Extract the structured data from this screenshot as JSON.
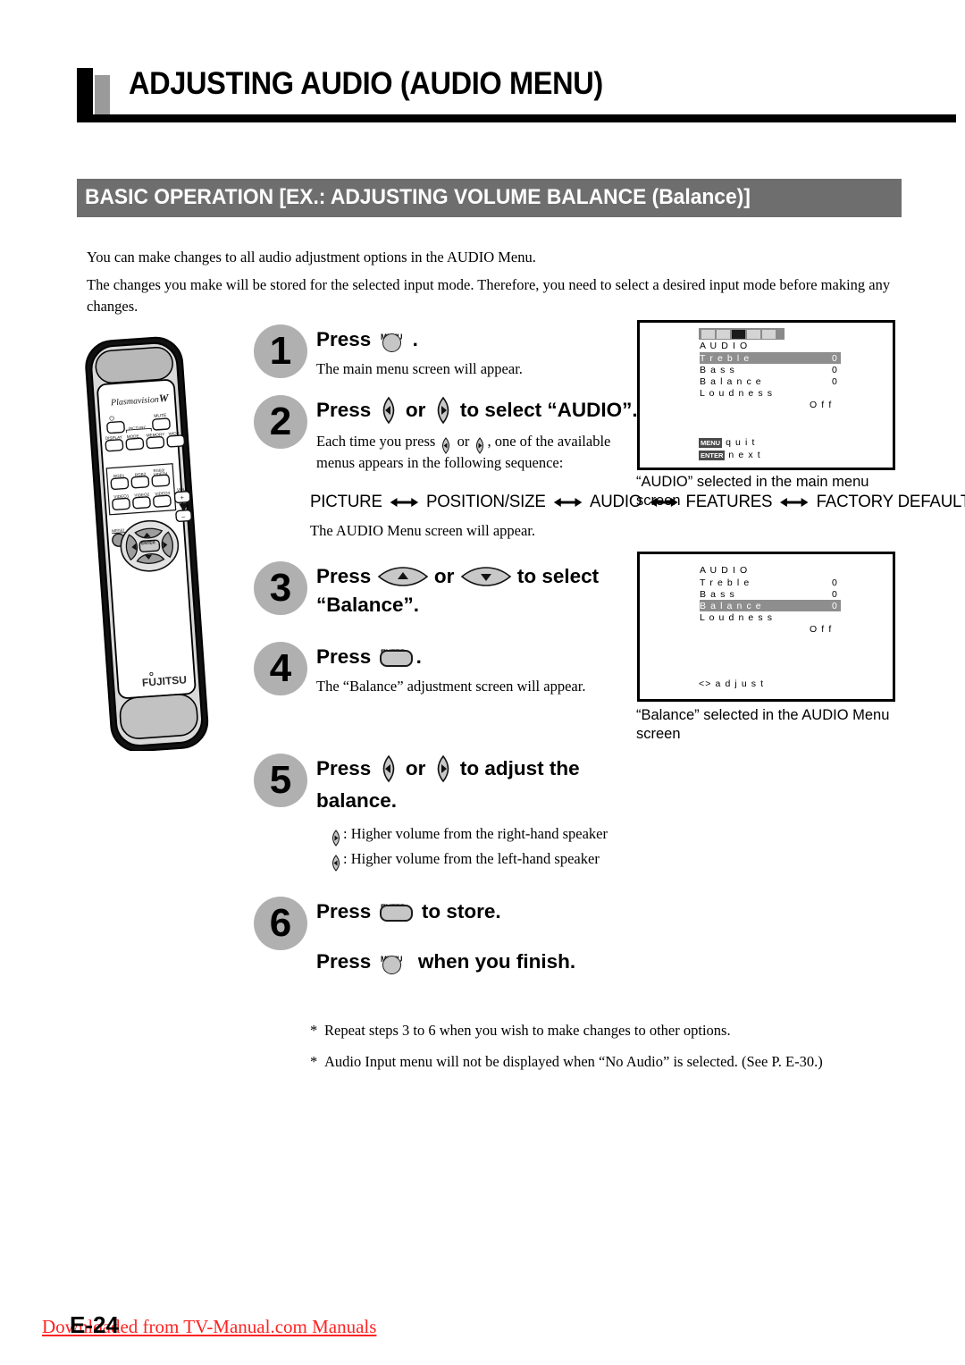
{
  "document": {
    "title": "ADJUSTING AUDIO (AUDIO MENU)",
    "section_banner": "BASIC OPERATION [EX.: ADJUSTING VOLUME BALANCE (Balance)]",
    "page_number": "E-24",
    "download_note": "Downloaded from TV-Manual.com Manuals"
  },
  "intro": {
    "paragraph_1": "You can make changes to all audio adjustment options in the AUDIO Menu.",
    "paragraph_2": "The changes you make will be stored for the selected input mode.  Therefore, you need to select a desired input mode before making any changes."
  },
  "remote": {
    "brand_top": "Plasmavision",
    "brand_top_mark": "W",
    "brand_bottom": "FUJITSU",
    "buttons": {
      "power": "⏻",
      "mute": "MUTE",
      "display": "DISPLAY",
      "picture_group": "PICTURE",
      "mode": "MODE",
      "memory": "MEMORY",
      "wide": "WIDE",
      "rgb1": "RGB1",
      "rgb2": "RGB2",
      "rgb3_video4": "RGB3/ VIDEO4",
      "video1": "VIDEO1",
      "video2": "VIDEO2",
      "video3": "VIDEO3",
      "vol": "VOL",
      "vol_plus": "+",
      "vol_minus": "–",
      "menu": "MENU",
      "enter": "ENTER"
    }
  },
  "steps": [
    {
      "number": "1",
      "head_pre": "Press",
      "key": "MENU",
      "head_post": ".",
      "body": "The main menu screen will appear."
    },
    {
      "number": "2",
      "head_pre": "Press",
      "head_mid": "or",
      "head_post": "to select “AUDIO”.",
      "body_line_1": ", one of the available",
      "body_pre": "Each time you press",
      "body_mid": "or",
      "body_line_2": "menus appears in the following sequence:",
      "body_after": "The AUDIO Menu screen will appear."
    },
    {
      "number": "3",
      "head_pre": "Press",
      "head_mid": "or",
      "head_post": "to select",
      "head_line2": "“Balance”."
    },
    {
      "number": "4",
      "head_pre": "Press",
      "key": "ENTER",
      "head_post": ".",
      "body": "The “Balance” adjustment screen will appear."
    },
    {
      "number": "5",
      "head_pre": "Press",
      "head_mid": "or",
      "head_post": "to adjust the",
      "head_line2": "balance.",
      "note_right": ": Higher volume from the right-hand speaker",
      "note_left": ": Higher volume from the left-hand speaker"
    },
    {
      "number": "6",
      "head_pre": "Press",
      "key": "ENTER",
      "head_post": "to store.",
      "head2_pre": "Press",
      "head2_key": "MENU",
      "head2_post": "when you finish."
    }
  ],
  "menu_sequence": {
    "items": [
      "PICTURE",
      "POSITION/SIZE",
      "AUDIO",
      "FEATURES",
      "FACTORY DEFAULT"
    ]
  },
  "osd_screens": [
    {
      "id": "main-menu",
      "icons": [
        "picture-icon",
        "position-size-icon",
        "audio-icon",
        "features-icon",
        "factory-default-icon"
      ],
      "selected_icon_index": 2,
      "title": "A U D I O",
      "rows": [
        {
          "label": "T r e b l e",
          "value": "0",
          "highlighted": true
        },
        {
          "label": "B a s s",
          "value": "0",
          "highlighted": false
        },
        {
          "label": "B a l a n c e",
          "value": "0",
          "highlighted": false
        },
        {
          "label": "L o u d n e s s",
          "value": "",
          "highlighted": false
        }
      ],
      "loudness_value": "O f f",
      "hints": [
        {
          "chip": "MENU",
          "text": "q u i t"
        },
        {
          "chip": "ENTER",
          "text": "n e x t"
        }
      ],
      "caption": "“AUDIO” selected in the main menu screen"
    },
    {
      "id": "audio-menu",
      "icons": [],
      "selected_icon_index": -1,
      "title": "A U D I O",
      "rows": [
        {
          "label": "T r e b l e",
          "value": "0",
          "highlighted": false
        },
        {
          "label": "B a s s",
          "value": "0",
          "highlighted": false
        },
        {
          "label": "B a l a n c e",
          "value": "0",
          "highlighted": true
        },
        {
          "label": "L o u d n e s s",
          "value": "",
          "highlighted": false
        }
      ],
      "loudness_value": "O f f",
      "hints": [
        {
          "chip": "",
          "text": "<>  a d j u s t"
        }
      ],
      "caption": "“Balance” selected in the AUDIO Menu screen"
    }
  ],
  "footnotes": [
    {
      "star": "*",
      "text": "Repeat steps 3 to 6 when you wish to make changes to other options."
    },
    {
      "star": "*",
      "text": "Audio Input menu will not be displayed when “No Audio” is selected. (See P. E-30.)"
    }
  ],
  "colors": {
    "banner_gray": "#6e6e6e",
    "step_circle_gray": "#b0b0b0",
    "osd_highlight": "#8e8e8e",
    "download_red": "#ff2222"
  }
}
